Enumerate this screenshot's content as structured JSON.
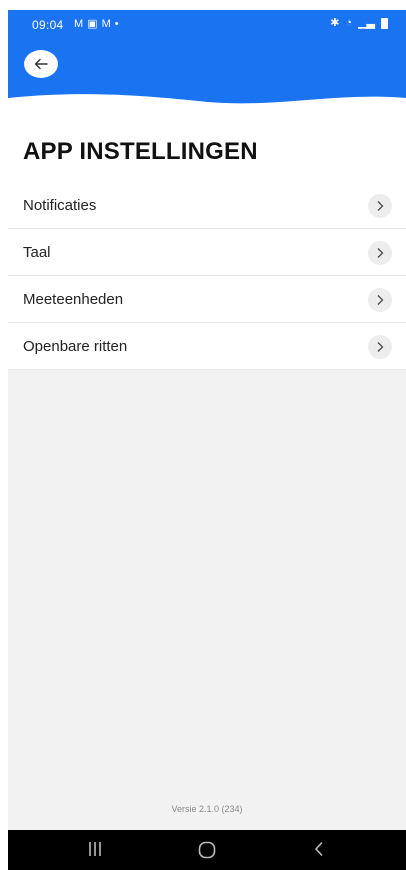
{
  "status_bar": {
    "time": "09:04",
    "left_icons": [
      "gmail-icon",
      "gallery-icon",
      "gmail-icon",
      "dot"
    ],
    "right_icons": [
      "bluetooth-icon",
      "wifi-icon",
      "signal-icon",
      "battery-icon"
    ]
  },
  "colors": {
    "header_blue": "#1a73f0",
    "background_grey": "#f2f2f2"
  },
  "header": {
    "back_icon": "arrow-left-icon"
  },
  "page": {
    "title": "APP INSTELLINGEN"
  },
  "settings": {
    "items": [
      {
        "label": "Notificaties"
      },
      {
        "label": "Taal"
      },
      {
        "label": "Meeteenheden"
      },
      {
        "label": "Openbare ritten"
      }
    ]
  },
  "footer": {
    "version": "Versie 2.1.0 (234)"
  },
  "nav_bar": {
    "buttons": [
      "recent-apps-icon",
      "home-icon",
      "back-icon"
    ]
  }
}
